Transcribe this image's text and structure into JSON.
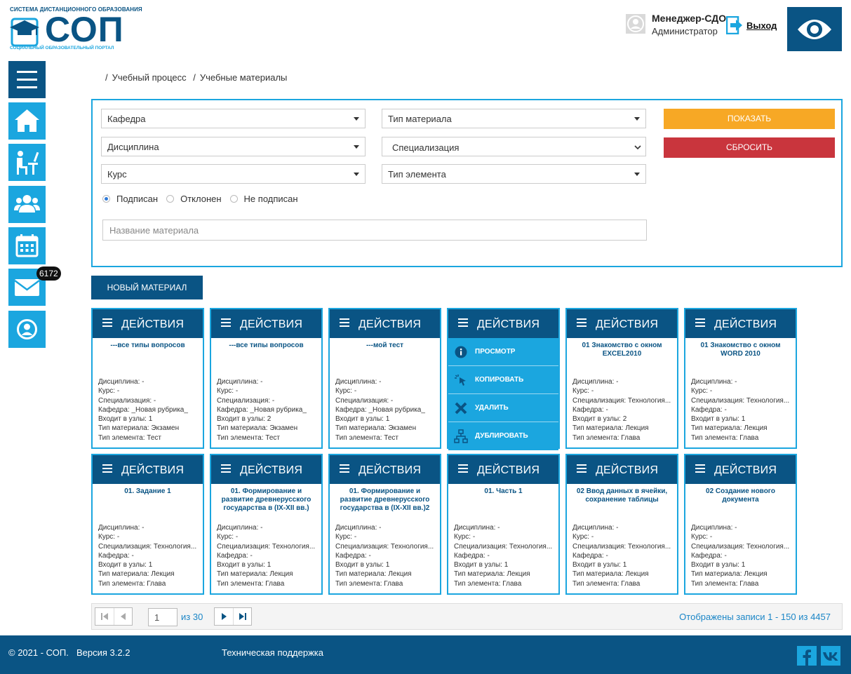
{
  "header": {
    "logo_top": "СИСТЕМА ДИСТАНЦИОННОГО ОБРАЗОВАНИЯ",
    "logo_word": "СОП",
    "logo_bottom": "СОЦИАЛЬНЫЙ ОБРАЗОВАТЕЛЬНЫЙ ПОРТАЛ",
    "user_name": "Менеджер-СДО",
    "user_role": "Администратор",
    "exit_label": "Выход"
  },
  "sidebar": {
    "items": [
      {
        "name": "menu",
        "icon": "hamburger-icon"
      },
      {
        "name": "home",
        "icon": "home-icon"
      },
      {
        "name": "learning",
        "icon": "student-desk-icon"
      },
      {
        "name": "users",
        "icon": "users-icon"
      },
      {
        "name": "calendar",
        "icon": "calendar-icon"
      },
      {
        "name": "messages",
        "icon": "mail-icon"
      },
      {
        "name": "profile",
        "icon": "user-circle-icon"
      }
    ],
    "mail_badge": "6172"
  },
  "breadcrumb": [
    "Учебный процесс",
    "Учебные материалы"
  ],
  "filters": {
    "department": "Кафедра",
    "material_type": "Тип материала",
    "discipline": "Дисциплина",
    "specialization": "Специализация",
    "course": "Курс",
    "element_type": "Тип элемента",
    "show_label": "ПОКАЗАТЬ",
    "reset_label": "СБРОСИТЬ",
    "radios": [
      "Подписан",
      "Отклонен",
      "Не подписан"
    ],
    "radio_selected": "Подписан",
    "name_placeholder": "Название материала"
  },
  "new_material_label": "НОВЫЙ МАТЕРИАЛ",
  "actions_label": "ДЕЙСТВИЯ",
  "labels": {
    "discipline": "Дисциплина: ",
    "course": "Курс: ",
    "specialization": "Специализация: ",
    "department": "Кафедра: ",
    "nodes": "Входит в узлы: ",
    "material_type": "Тип материала: ",
    "element_type": "Тип элемента: "
  },
  "action_menu": [
    "ПРОСМОТР",
    "КОПИРОВАТЬ",
    "УДАЛИТЬ",
    "ДУБЛИРОВАТЬ"
  ],
  "cards": [
    {
      "title": "---все типы вопросов",
      "discipline": "-",
      "course": "-",
      "specialization": "-",
      "department": "_Новая рубрика_",
      "nodes": "1",
      "material_type": "Экзамен",
      "element_type": "Тест"
    },
    {
      "title": "---все типы вопросов",
      "discipline": "-",
      "course": "-",
      "specialization": "-",
      "department": "_Новая рубрика_",
      "nodes": "2",
      "material_type": "Экзамен",
      "element_type": "Тест"
    },
    {
      "title": "---мой тест",
      "discipline": "-",
      "course": "-",
      "specialization": "-",
      "department": "_Новая рубрика_",
      "nodes": "1",
      "material_type": "Экзамен",
      "element_type": "Тест"
    },
    {
      "title": "",
      "discipline": "",
      "course": "",
      "specialization": "",
      "department": "",
      "nodes": "",
      "material_type": "",
      "element_type": ""
    },
    {
      "title": "01 Знакомство с окном EXCEL2010",
      "discipline": "-",
      "course": "-",
      "specialization": "Технология...",
      "department": "-",
      "nodes": "2",
      "material_type": "Лекция",
      "element_type": "Глава"
    },
    {
      "title": "01 Знакомство с окном WORD 2010",
      "discipline": "-",
      "course": "-",
      "specialization": "Технология...",
      "department": "-",
      "nodes": "1",
      "material_type": "Лекция",
      "element_type": "Глава"
    },
    {
      "title": "01. Задание 1",
      "discipline": "-",
      "course": "-",
      "specialization": "Технология...",
      "department": "-",
      "nodes": "1",
      "material_type": "Лекция",
      "element_type": "Глава"
    },
    {
      "title": "01. Формирование и развитие древнерусского государства в (IX-XII вв.)",
      "discipline": "-",
      "course": "-",
      "specialization": "Технология...",
      "department": "-",
      "nodes": "1",
      "material_type": "Лекция",
      "element_type": "Глава"
    },
    {
      "title": "01. Формирование и развитие древнерусского государства в (IX-XII вв.)2",
      "discipline": "-",
      "course": "-",
      "specialization": "Технология...",
      "department": "-",
      "nodes": "1",
      "material_type": "Лекция",
      "element_type": "Глава"
    },
    {
      "title": "01. Часть 1",
      "discipline": "-",
      "course": "-",
      "specialization": "Технология...",
      "department": "-",
      "nodes": "1",
      "material_type": "Лекция",
      "element_type": "Глава"
    },
    {
      "title": "02 Ввод данных в ячейки, сохранение таблицы",
      "discipline": "-",
      "course": "-",
      "specialization": "Технология...",
      "department": "-",
      "nodes": "1",
      "material_type": "Лекция",
      "element_type": "Глава"
    },
    {
      "title": "02 Создание нового документа",
      "discipline": "-",
      "course": "-",
      "specialization": "Технология...",
      "department": "-",
      "nodes": "1",
      "material_type": "Лекция",
      "element_type": "Глава"
    }
  ],
  "pager": {
    "page": "1",
    "of_label": "из 30",
    "info": "Отображены записи 1 - 150 из 4457"
  },
  "footer": {
    "copyright": "© 2021 - СОП.",
    "version": "Версия 3.2.2",
    "support": "Техническая поддержка"
  },
  "colors": {
    "primary": "#0a5484",
    "accent": "#1ba6df",
    "show": "#f7a825",
    "reset": "#c9353d"
  }
}
